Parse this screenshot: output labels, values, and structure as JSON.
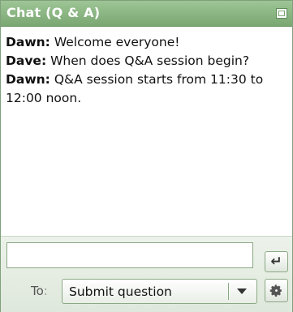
{
  "title": "Chat (Q & A)",
  "icons": {
    "maximize": "maximize-icon",
    "send": "enter-icon",
    "dropdown": "chevron-down-icon",
    "settings": "gear-icon"
  },
  "messages": [
    {
      "author": "Dawn:",
      "text": " Welcome everyone!"
    },
    {
      "author": "Dave:",
      "text": " When does Q&A session begin?"
    },
    {
      "author": "Dawn:",
      "text": " Q&A session starts from 11:30 to 12:00 noon."
    }
  ],
  "input": {
    "value": "",
    "placeholder": ""
  },
  "to_label": "To",
  "to_colon": ":",
  "recipient": {
    "selected": "Submit question"
  },
  "send_glyph": "↵",
  "colors": {
    "titlebar": "#7aa772",
    "border": "#8aa884",
    "footer": "#dfe8dc"
  }
}
